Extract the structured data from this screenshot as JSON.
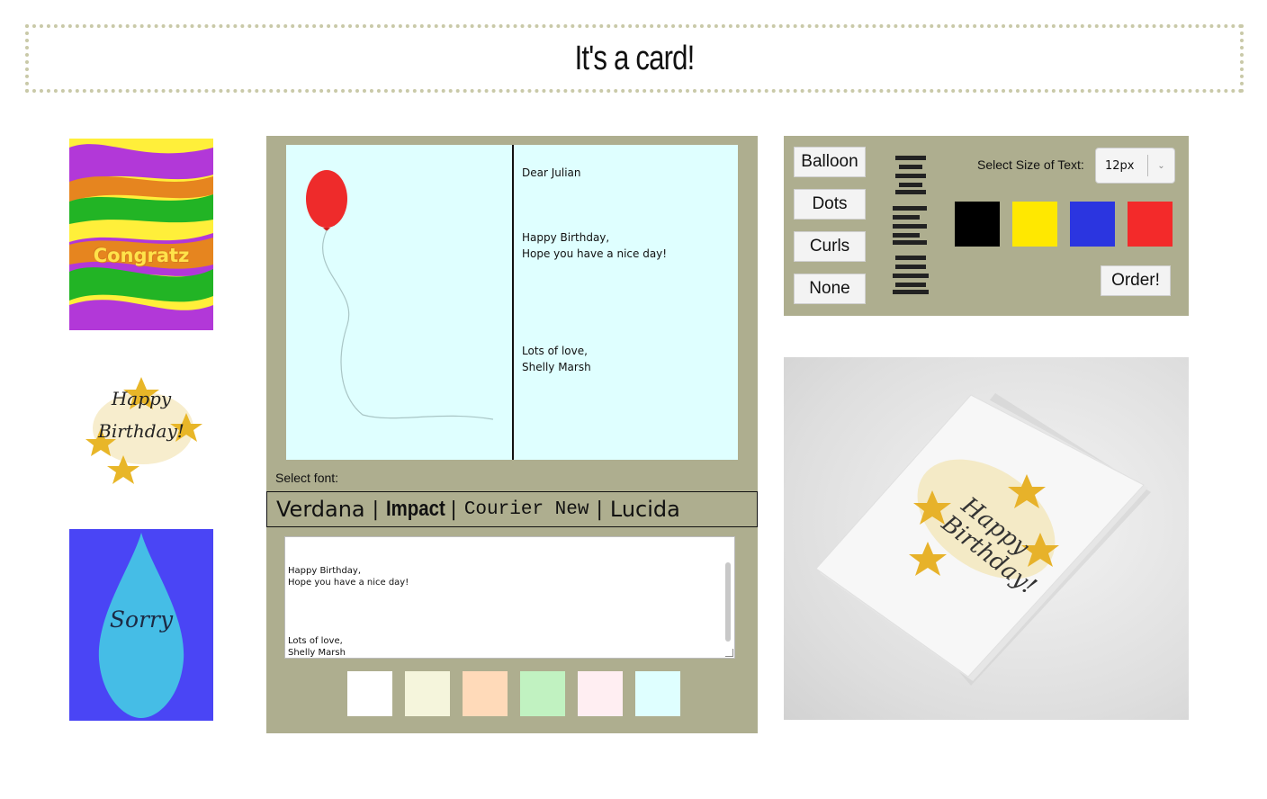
{
  "header": {
    "title": "It's a card!"
  },
  "templates": [
    {
      "name": "congratz",
      "text": "Congratz"
    },
    {
      "name": "birthday",
      "text_line1": "Happy",
      "text_line2": "Birthday!"
    },
    {
      "name": "sorry",
      "text": "Sorry"
    }
  ],
  "card": {
    "greeting": "Dear Julian",
    "message": "Happy Birthday,\nHope you have a nice day!",
    "signoff": "Lots of love,\nShelly Marsh",
    "background": "#dfffff",
    "balloon_color": "#ee2b2b"
  },
  "font_picker": {
    "label": "Select font:",
    "options": [
      "Verdana",
      "Impact",
      "Courier New",
      "Lucida"
    ],
    "separator": "|"
  },
  "message_input": {
    "value": "Happy Birthday,\nHope you have a nice day!\n\n\n\n\nLots of love,\nShelly Marsh"
  },
  "background_swatches": [
    "#ffffff",
    "#f5f5dc",
    "#ffdab9",
    "#c1f2c1",
    "#ffeef2",
    "#dfffff"
  ],
  "decorations": [
    "Balloon",
    "Dots",
    "Curls",
    "None"
  ],
  "alignment_icons": [
    "align-center-icon",
    "align-right-icon",
    "align-justify-icon"
  ],
  "text_size": {
    "label": "Select Size of Text:",
    "value": "12px"
  },
  "text_colors": [
    "#000000",
    "#ffe800",
    "#2b35e0",
    "#f32a2a"
  ],
  "order_button": {
    "label": "Order!"
  },
  "mockup": {
    "line1": "Happy",
    "line2": "Birthday!"
  },
  "colors": {
    "panel": "#aeae8f",
    "header_border": "#c9c9a8"
  }
}
